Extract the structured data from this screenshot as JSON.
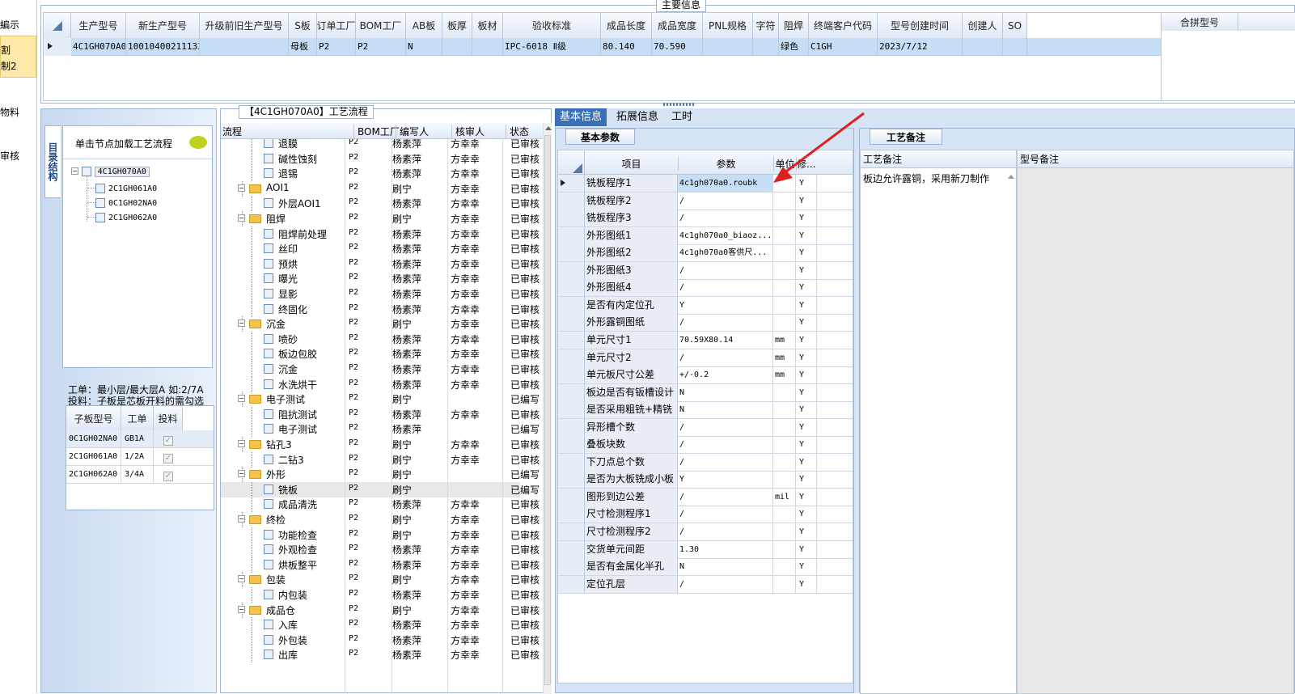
{
  "left_edge": {
    "items": [
      "編示",
      "割",
      "制2",
      "物料",
      "审核"
    ]
  },
  "main_info": {
    "title": "主要信息",
    "columns": [
      "生产型号",
      "新生产型号",
      "升级前旧生产型号",
      "S板",
      "订单工厂",
      "BOM工厂",
      "AB板",
      "板厚",
      "板材",
      "验收标准",
      "成品长度",
      "成品宽度",
      "PNL规格",
      "字符",
      "阻焊",
      "终端客户代码",
      "型号创建时间",
      "创建人",
      "SO"
    ],
    "row": [
      "4C1GH070A0",
      "10010400211133",
      "",
      "母板",
      "P2",
      "P2",
      "N",
      "",
      "",
      "IPC-6018 Ⅱ级",
      "80.140",
      "70.590",
      "",
      "",
      "绿色",
      "C1GH",
      "2023/7/12",
      "",
      ""
    ],
    "side_columns": [
      "合拼型号"
    ]
  },
  "left_panel": {
    "vertical_tab": "目录结构",
    "hint": "单击节点加载工艺流程",
    "tree_root": "4C1GH070A0",
    "tree_children": [
      "2C1GH061A0",
      "0C1GH02NA0",
      "2C1GH062A0"
    ],
    "note_line1": "工单：最小层/最大层A 如:2/7A",
    "note_line2": "投料：子板是芯板开料的需勾选",
    "sub_headers": [
      "子板型号",
      "工单",
      "投料"
    ],
    "sub_rows": [
      {
        "model": "0C1GH02NA0",
        "order": "GB1A",
        "feed": "✓"
      },
      {
        "model": "2C1GH061A0",
        "order": "1/2A",
        "feed": "✓"
      },
      {
        "model": "2C1GH062A0",
        "order": "3/4A",
        "feed": "✓"
      }
    ]
  },
  "process": {
    "title": "【4C1GH070A0】工艺流程",
    "headers": [
      "流程",
      "BOM工厂",
      "编写人",
      "核审人",
      "状态"
    ],
    "rows": [
      {
        "t": "c",
        "name": "退膜",
        "bom": "P2",
        "writer": "杨素萍",
        "reviewer": "方幸幸",
        "status": "已审核"
      },
      {
        "t": "c",
        "name": "碱性蚀刻",
        "bom": "P2",
        "writer": "杨素萍",
        "reviewer": "方幸幸",
        "status": "已审核"
      },
      {
        "t": "c",
        "name": "退锡",
        "bom": "P2",
        "writer": "杨素萍",
        "reviewer": "方幸幸",
        "status": "已审核"
      },
      {
        "t": "g",
        "name": "AOI1",
        "bom": "P2",
        "writer": "刷宁",
        "reviewer": "方幸幸",
        "status": "已审核"
      },
      {
        "t": "c",
        "name": "外层AOI1",
        "bom": "P2",
        "writer": "杨素萍",
        "reviewer": "方幸幸",
        "status": "已审核"
      },
      {
        "t": "g",
        "name": "阻焊",
        "bom": "P2",
        "writer": "刷宁",
        "reviewer": "方幸幸",
        "status": "已审核"
      },
      {
        "t": "c",
        "name": "阻焊前处理",
        "bom": "P2",
        "writer": "杨素萍",
        "reviewer": "方幸幸",
        "status": "已审核"
      },
      {
        "t": "c",
        "name": "丝印",
        "bom": "P2",
        "writer": "杨素萍",
        "reviewer": "方幸幸",
        "status": "已审核"
      },
      {
        "t": "c",
        "name": "预烘",
        "bom": "P2",
        "writer": "杨素萍",
        "reviewer": "方幸幸",
        "status": "已审核"
      },
      {
        "t": "c",
        "name": "曝光",
        "bom": "P2",
        "writer": "杨素萍",
        "reviewer": "方幸幸",
        "status": "已审核"
      },
      {
        "t": "c",
        "name": "显影",
        "bom": "P2",
        "writer": "杨素萍",
        "reviewer": "方幸幸",
        "status": "已审核"
      },
      {
        "t": "c",
        "name": "终固化",
        "bom": "P2",
        "writer": "杨素萍",
        "reviewer": "方幸幸",
        "status": "已审核"
      },
      {
        "t": "g",
        "name": "沉金",
        "bom": "P2",
        "writer": "刷宁",
        "reviewer": "方幸幸",
        "status": "已审核"
      },
      {
        "t": "c",
        "name": "喷砂",
        "bom": "P2",
        "writer": "杨素萍",
        "reviewer": "方幸幸",
        "status": "已审核"
      },
      {
        "t": "c",
        "name": "板边包胶",
        "bom": "P2",
        "writer": "杨素萍",
        "reviewer": "方幸幸",
        "status": "已审核"
      },
      {
        "t": "c",
        "name": "沉金",
        "bom": "P2",
        "writer": "杨素萍",
        "reviewer": "方幸幸",
        "status": "已审核"
      },
      {
        "t": "c",
        "name": "水洗烘干",
        "bom": "P2",
        "writer": "杨素萍",
        "reviewer": "方幸幸",
        "status": "已审核"
      },
      {
        "t": "g",
        "name": "电子测试",
        "bom": "P2",
        "writer": "刷宁",
        "reviewer": "",
        "status": "已编写"
      },
      {
        "t": "c",
        "name": "阻抗测试",
        "bom": "P2",
        "writer": "杨素萍",
        "reviewer": "方幸幸",
        "status": "已审核"
      },
      {
        "t": "c",
        "name": "电子测试",
        "bom": "P2",
        "writer": "杨素萍",
        "reviewer": "",
        "status": "已编写"
      },
      {
        "t": "g",
        "name": "钻孔3",
        "bom": "P2",
        "writer": "刷宁",
        "reviewer": "方幸幸",
        "status": "已审核"
      },
      {
        "t": "c",
        "name": "二钻3",
        "bom": "P2",
        "writer": "刷宁",
        "reviewer": "方幸幸",
        "status": "已审核"
      },
      {
        "t": "g",
        "name": "外形",
        "bom": "P2",
        "writer": "刷宁",
        "reviewer": "",
        "status": "已编写"
      },
      {
        "t": "c",
        "name": "铣板",
        "bom": "P2",
        "writer": "刷宁",
        "reviewer": "",
        "status": "已编写",
        "sel": true
      },
      {
        "t": "c",
        "name": "成品清洗",
        "bom": "P2",
        "writer": "杨素萍",
        "reviewer": "方幸幸",
        "status": "已审核"
      },
      {
        "t": "g",
        "name": "终检",
        "bom": "P2",
        "writer": "刷宁",
        "reviewer": "方幸幸",
        "status": "已审核"
      },
      {
        "t": "c",
        "name": "功能检查",
        "bom": "P2",
        "writer": "刷宁",
        "reviewer": "方幸幸",
        "status": "已审核"
      },
      {
        "t": "c",
        "name": "外观检查",
        "bom": "P2",
        "writer": "杨素萍",
        "reviewer": "方幸幸",
        "status": "已审核"
      },
      {
        "t": "c",
        "name": "烘板整平",
        "bom": "P2",
        "writer": "杨素萍",
        "reviewer": "方幸幸",
        "status": "已审核"
      },
      {
        "t": "g",
        "name": "包装",
        "bom": "P2",
        "writer": "刷宁",
        "reviewer": "方幸幸",
        "status": "已审核"
      },
      {
        "t": "c",
        "name": "内包装",
        "bom": "P2",
        "writer": "杨素萍",
        "reviewer": "方幸幸",
        "status": "已审核"
      },
      {
        "t": "g",
        "name": "成品仓",
        "bom": "P2",
        "writer": "刷宁",
        "reviewer": "方幸幸",
        "status": "已审核"
      },
      {
        "t": "c",
        "name": "入库",
        "bom": "P2",
        "writer": "杨素萍",
        "reviewer": "方幸幸",
        "status": "已审核"
      },
      {
        "t": "c",
        "name": "外包装",
        "bom": "P2",
        "writer": "杨素萍",
        "reviewer": "方幸幸",
        "status": "已审核"
      },
      {
        "t": "c",
        "name": "出库",
        "bom": "P2",
        "writer": "杨素萍",
        "reviewer": "方幸幸",
        "status": "已审核"
      }
    ]
  },
  "detail": {
    "tabs": [
      "基本信息",
      "拓展信息",
      "工时"
    ],
    "params_tab": "基本参数",
    "param_headers": [
      "项目",
      "参数",
      "单位",
      "修..."
    ],
    "params": [
      {
        "item": "铣板程序1",
        "value": "4c1gh070a0.roubk",
        "unit": "",
        "mod": "Y"
      },
      {
        "item": "铣板程序2",
        "value": "/",
        "unit": "",
        "mod": "Y"
      },
      {
        "item": "铣板程序3",
        "value": "/",
        "unit": "",
        "mod": "Y"
      },
      {
        "item": "外形图纸1",
        "value": "4c1gh070a0_biaoz...",
        "unit": "",
        "mod": "Y"
      },
      {
        "item": "外形图纸2",
        "value": "4c1gh070a0客供尺...",
        "unit": "",
        "mod": "Y"
      },
      {
        "item": "外形图纸3",
        "value": "/",
        "unit": "",
        "mod": "Y"
      },
      {
        "item": "外形图纸4",
        "value": "/",
        "unit": "",
        "mod": "Y"
      },
      {
        "item": "是否有内定位孔",
        "value": "Y",
        "unit": "",
        "mod": "Y"
      },
      {
        "item": "外形露铜图纸",
        "value": "/",
        "unit": "",
        "mod": "Y"
      },
      {
        "item": "单元尺寸1",
        "value": "70.59X80.14",
        "unit": "mm",
        "mod": "Y"
      },
      {
        "item": "单元尺寸2",
        "value": "/",
        "unit": "mm",
        "mod": "Y"
      },
      {
        "item": "单元板尺寸公差",
        "value": "+/-0.2",
        "unit": "mm",
        "mod": "Y"
      },
      {
        "item": "板边是否有钣槽设计",
        "value": "N",
        "unit": "",
        "mod": "Y"
      },
      {
        "item": "是否采用粗铣+精铣",
        "value": "N",
        "unit": "",
        "mod": "Y"
      },
      {
        "item": "异形槽个数",
        "value": "/",
        "unit": "",
        "mod": "Y"
      },
      {
        "item": "叠板块数",
        "value": "/",
        "unit": "",
        "mod": "Y"
      },
      {
        "item": "下刀点总个数",
        "value": "/",
        "unit": "",
        "mod": "Y"
      },
      {
        "item": "是否为大板铣成小板",
        "value": "Y",
        "unit": "",
        "mod": "Y"
      },
      {
        "item": "图形到边公差",
        "value": "/",
        "unit": "mil",
        "mod": "Y"
      },
      {
        "item": "尺寸检测程序1",
        "value": "/",
        "unit": "",
        "mod": "Y"
      },
      {
        "item": "尺寸检测程序2",
        "value": "/",
        "unit": "",
        "mod": "Y"
      },
      {
        "item": "交货单元间距",
        "value": "1.30",
        "unit": "",
        "mod": "Y"
      },
      {
        "item": "是否有金属化半孔",
        "value": "N",
        "unit": "",
        "mod": "Y"
      },
      {
        "item": "定位孔层",
        "value": "/",
        "unit": "",
        "mod": "Y"
      }
    ],
    "remarks_tab": "工艺备注",
    "remark_headers": [
      "工艺备注",
      "型号备注"
    ],
    "remark_text": "板边允许露铜，采用新刀制作"
  },
  "colors": {
    "selection": "#c6dff6",
    "header": "#dfe9f6",
    "accent": "#e02020",
    "panel": "#d6e4f5"
  }
}
